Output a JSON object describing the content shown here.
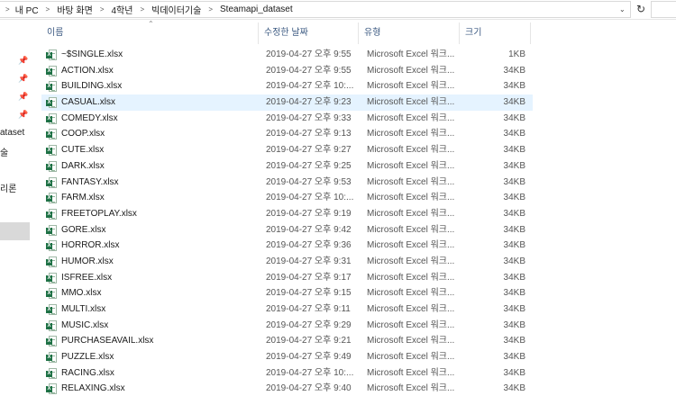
{
  "breadcrumbs": [
    "내 PC",
    "바탕 화면",
    "4학년",
    "빅데이터기술",
    "Steamapi_dataset"
  ],
  "nav": {
    "items": [
      "ataset",
      "술",
      "리론"
    ]
  },
  "columns": {
    "name": "이름",
    "date": "수정한 날짜",
    "type": "유형",
    "size": "크기"
  },
  "files": [
    {
      "name": "~$SINGLE.xlsx",
      "date": "2019-04-27 오후 9:55",
      "type": "Microsoft Excel 워크...",
      "size": "1KB"
    },
    {
      "name": "ACTION.xlsx",
      "date": "2019-04-27 오후 9:55",
      "type": "Microsoft Excel 워크...",
      "size": "34KB"
    },
    {
      "name": "BUILDING.xlsx",
      "date": "2019-04-27 오후 10:...",
      "type": "Microsoft Excel 워크...",
      "size": "34KB"
    },
    {
      "name": "CASUAL.xlsx",
      "date": "2019-04-27 오후 9:23",
      "type": "Microsoft Excel 워크...",
      "size": "34KB",
      "selected": true
    },
    {
      "name": "COMEDY.xlsx",
      "date": "2019-04-27 오후 9:33",
      "type": "Microsoft Excel 워크...",
      "size": "34KB"
    },
    {
      "name": "COOP.xlsx",
      "date": "2019-04-27 오후 9:13",
      "type": "Microsoft Excel 워크...",
      "size": "34KB"
    },
    {
      "name": "CUTE.xlsx",
      "date": "2019-04-27 오후 9:27",
      "type": "Microsoft Excel 워크...",
      "size": "34KB"
    },
    {
      "name": "DARK.xlsx",
      "date": "2019-04-27 오후 9:25",
      "type": "Microsoft Excel 워크...",
      "size": "34KB"
    },
    {
      "name": "FANTASY.xlsx",
      "date": "2019-04-27 오후 9:53",
      "type": "Microsoft Excel 워크...",
      "size": "34KB"
    },
    {
      "name": "FARM.xlsx",
      "date": "2019-04-27 오후 10:...",
      "type": "Microsoft Excel 워크...",
      "size": "34KB"
    },
    {
      "name": "FREETOPLAY.xlsx",
      "date": "2019-04-27 오후 9:19",
      "type": "Microsoft Excel 워크...",
      "size": "34KB"
    },
    {
      "name": "GORE.xlsx",
      "date": "2019-04-27 오후 9:42",
      "type": "Microsoft Excel 워크...",
      "size": "34KB"
    },
    {
      "name": "HORROR.xlsx",
      "date": "2019-04-27 오후 9:36",
      "type": "Microsoft Excel 워크...",
      "size": "34KB"
    },
    {
      "name": "HUMOR.xlsx",
      "date": "2019-04-27 오후 9:31",
      "type": "Microsoft Excel 워크...",
      "size": "34KB"
    },
    {
      "name": "ISFREE.xlsx",
      "date": "2019-04-27 오후 9:17",
      "type": "Microsoft Excel 워크...",
      "size": "34KB"
    },
    {
      "name": "MMO.xlsx",
      "date": "2019-04-27 오후 9:15",
      "type": "Microsoft Excel 워크...",
      "size": "34KB"
    },
    {
      "name": "MULTI.xlsx",
      "date": "2019-04-27 오후 9:11",
      "type": "Microsoft Excel 워크...",
      "size": "34KB"
    },
    {
      "name": "MUSIC.xlsx",
      "date": "2019-04-27 오후 9:29",
      "type": "Microsoft Excel 워크...",
      "size": "34KB"
    },
    {
      "name": "PURCHASEAVAIL.xlsx",
      "date": "2019-04-27 오후 9:21",
      "type": "Microsoft Excel 워크...",
      "size": "34KB"
    },
    {
      "name": "PUZZLE.xlsx",
      "date": "2019-04-27 오후 9:49",
      "type": "Microsoft Excel 워크...",
      "size": "34KB"
    },
    {
      "name": "RACING.xlsx",
      "date": "2019-04-27 오후 10:...",
      "type": "Microsoft Excel 워크...",
      "size": "34KB"
    },
    {
      "name": "RELAXING.xlsx",
      "date": "2019-04-27 오후 9:40",
      "type": "Microsoft Excel 워크...",
      "size": "34KB"
    }
  ],
  "colors": {
    "selection": "#e5f3ff",
    "header_text": "#3c5a82",
    "excel_green": "#1e7145"
  },
  "icons": {
    "file": "excel-file-icon",
    "pin": "pin-icon",
    "refresh": "refresh-icon"
  }
}
